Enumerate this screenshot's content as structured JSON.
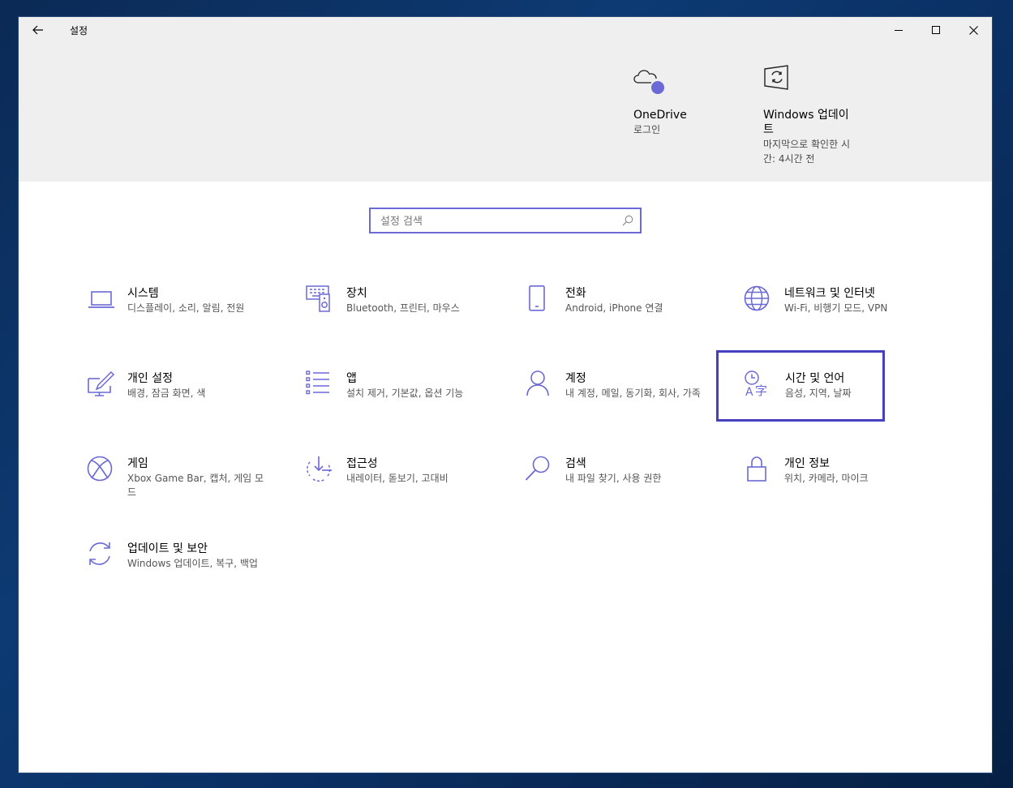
{
  "window": {
    "title": "설정"
  },
  "header": {
    "tiles": [
      {
        "title": "OneDrive",
        "sub": "로그인",
        "icon": "onedrive-cloud-icon"
      },
      {
        "title": "Windows 업데이트",
        "sub": "마지막으로 확인한 시간: 4시간 전",
        "icon": "windows-update-icon"
      }
    ]
  },
  "search": {
    "placeholder": "설정 검색"
  },
  "categories": [
    {
      "label": "시스템",
      "desc": "디스플레이, 소리, 알림, 전원",
      "icon": "laptop-icon"
    },
    {
      "label": "장치",
      "desc": "Bluetooth, 프린터, 마우스",
      "icon": "devices-icon"
    },
    {
      "label": "전화",
      "desc": "Android, iPhone 연결",
      "icon": "phone-icon"
    },
    {
      "label": "네트워크 및 인터넷",
      "desc": "Wi-Fi, 비행기 모드, VPN",
      "icon": "globe-icon"
    },
    {
      "label": "개인 설정",
      "desc": "배경, 잠금 화면, 색",
      "icon": "personalization-icon"
    },
    {
      "label": "앱",
      "desc": "설치 제거, 기본값, 옵션 기능",
      "icon": "apps-list-icon"
    },
    {
      "label": "계정",
      "desc": "내 계정, 메일, 동기화, 회사, 가족",
      "icon": "person-icon"
    },
    {
      "label": "시간 및 언어",
      "desc": "음성, 지역, 날짜",
      "icon": "time-language-icon"
    },
    {
      "label": "게임",
      "desc": "Xbox Game Bar, 캡처, 게임 모드",
      "icon": "xbox-icon"
    },
    {
      "label": "접근성",
      "desc": "내레이터, 돋보기, 고대비",
      "icon": "accessibility-icon"
    },
    {
      "label": "검색",
      "desc": "내 파일 찾기, 사용 권한",
      "icon": "search-icon"
    },
    {
      "label": "개인 정보",
      "desc": "위치, 카메라, 마이크",
      "icon": "lock-icon"
    },
    {
      "label": "업데이트 및 보안",
      "desc": "Windows 업데이트, 복구, 백업",
      "icon": "update-icon"
    }
  ],
  "colors": {
    "accent": "#6b69d6",
    "focus": "#4540c0",
    "header_bg": "#efefef"
  }
}
